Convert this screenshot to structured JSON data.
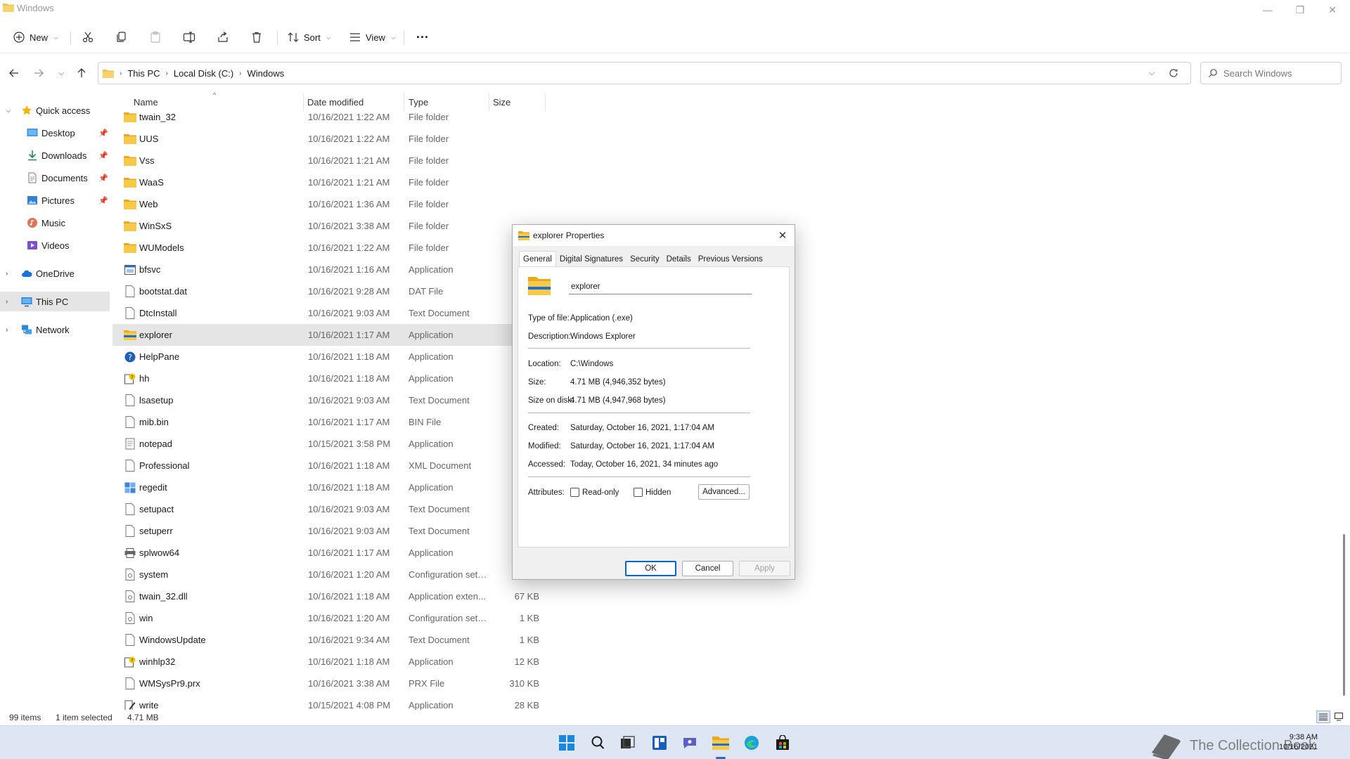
{
  "window": {
    "title": "Windows",
    "controls": {
      "minimize": "—",
      "maximize": "❐",
      "close": "✕"
    }
  },
  "toolbar": {
    "new_label": "New",
    "sort_label": "Sort",
    "view_label": "View",
    "more_label": "···"
  },
  "address": {
    "crumbs": [
      "This PC",
      "Local Disk (C:)",
      "Windows"
    ],
    "search_placeholder": "Search Windows"
  },
  "sidebar": {
    "items": [
      {
        "label": "Quick access",
        "icon": "star-icon"
      },
      {
        "label": "Desktop",
        "icon": "desktop-icon"
      },
      {
        "label": "Downloads",
        "icon": "downloads-icon"
      },
      {
        "label": "Documents",
        "icon": "documents-icon"
      },
      {
        "label": "Pictures",
        "icon": "pictures-icon"
      },
      {
        "label": "Music",
        "icon": "music-icon"
      },
      {
        "label": "Videos",
        "icon": "videos-icon"
      },
      {
        "label": "OneDrive",
        "icon": "cloud-icon"
      },
      {
        "label": "This PC",
        "icon": "computer-icon"
      },
      {
        "label": "Network",
        "icon": "network-icon"
      }
    ]
  },
  "columns": {
    "name": "Name",
    "date": "Date modified",
    "type": "Type",
    "size": "Size"
  },
  "files": [
    {
      "name": "twain_32",
      "date": "10/16/2021 1:22 AM",
      "type": "File folder",
      "size": "",
      "icon": "folder"
    },
    {
      "name": "UUS",
      "date": "10/16/2021 1:22 AM",
      "type": "File folder",
      "size": "",
      "icon": "folder"
    },
    {
      "name": "Vss",
      "date": "10/16/2021 1:21 AM",
      "type": "File folder",
      "size": "",
      "icon": "folder"
    },
    {
      "name": "WaaS",
      "date": "10/16/2021 1:21 AM",
      "type": "File folder",
      "size": "",
      "icon": "folder"
    },
    {
      "name": "Web",
      "date": "10/16/2021 1:36 AM",
      "type": "File folder",
      "size": "",
      "icon": "folder"
    },
    {
      "name": "WinSxS",
      "date": "10/16/2021 3:38 AM",
      "type": "File folder",
      "size": "",
      "icon": "folder"
    },
    {
      "name": "WUModels",
      "date": "10/16/2021 1:22 AM",
      "type": "File folder",
      "size": "",
      "icon": "folder"
    },
    {
      "name": "bfsvc",
      "date": "10/16/2021 1:16 AM",
      "type": "Application",
      "size": "",
      "icon": "app"
    },
    {
      "name": "bootstat.dat",
      "date": "10/16/2021 9:28 AM",
      "type": "DAT File",
      "size": "",
      "icon": "file"
    },
    {
      "name": "DtcInstall",
      "date": "10/16/2021 9:03 AM",
      "type": "Text Document",
      "size": "",
      "icon": "file"
    },
    {
      "name": "explorer",
      "date": "10/16/2021 1:17 AM",
      "type": "Application",
      "size": "",
      "icon": "explorer"
    },
    {
      "name": "HelpPane",
      "date": "10/16/2021 1:18 AM",
      "type": "Application",
      "size": "",
      "icon": "help"
    },
    {
      "name": "hh",
      "date": "10/16/2021 1:18 AM",
      "type": "Application",
      "size": "",
      "icon": "hh"
    },
    {
      "name": "lsasetup",
      "date": "10/16/2021 9:03 AM",
      "type": "Text Document",
      "size": "",
      "icon": "file"
    },
    {
      "name": "mib.bin",
      "date": "10/16/2021 1:17 AM",
      "type": "BIN File",
      "size": "",
      "icon": "file"
    },
    {
      "name": "notepad",
      "date": "10/15/2021 3:58 PM",
      "type": "Application",
      "size": "",
      "icon": "notepad"
    },
    {
      "name": "Professional",
      "date": "10/16/2021 1:18 AM",
      "type": "XML Document",
      "size": "",
      "icon": "file"
    },
    {
      "name": "regedit",
      "date": "10/16/2021 1:18 AM",
      "type": "Application",
      "size": "",
      "icon": "regedit"
    },
    {
      "name": "setupact",
      "date": "10/16/2021 9:03 AM",
      "type": "Text Document",
      "size": "",
      "icon": "file"
    },
    {
      "name": "setuperr",
      "date": "10/16/2021 9:03 AM",
      "type": "Text Document",
      "size": "",
      "icon": "file"
    },
    {
      "name": "splwow64",
      "date": "10/16/2021 1:17 AM",
      "type": "Application",
      "size": "",
      "icon": "printer"
    },
    {
      "name": "system",
      "date": "10/16/2021 1:20 AM",
      "type": "Configuration sett...",
      "size": "",
      "icon": "config"
    },
    {
      "name": "twain_32.dll",
      "date": "10/16/2021 1:18 AM",
      "type": "Application exten...",
      "size": "67 KB",
      "icon": "config"
    },
    {
      "name": "win",
      "date": "10/16/2021 1:20 AM",
      "type": "Configuration sett...",
      "size": "1 KB",
      "icon": "config"
    },
    {
      "name": "WindowsUpdate",
      "date": "10/16/2021 9:34 AM",
      "type": "Text Document",
      "size": "1 KB",
      "icon": "file"
    },
    {
      "name": "winhlp32",
      "date": "10/16/2021 1:18 AM",
      "type": "Application",
      "size": "12 KB",
      "icon": "hh"
    },
    {
      "name": "WMSysPr9.prx",
      "date": "10/16/2021 3:38 AM",
      "type": "PRX File",
      "size": "310 KB",
      "icon": "file"
    },
    {
      "name": "write",
      "date": "10/15/2021 4:08 PM",
      "type": "Application",
      "size": "28 KB",
      "icon": "write"
    }
  ],
  "selected_file": "explorer",
  "status": {
    "items": "99 items",
    "selected": "1 item selected",
    "size": "4.71 MB"
  },
  "taskbar": {
    "time": "9:38 AM",
    "date": "10/16/2021",
    "watermark": "The Collection Book"
  },
  "dialog": {
    "title": "explorer Properties",
    "tabs": [
      "General",
      "Digital Signatures",
      "Security",
      "Details",
      "Previous Versions"
    ],
    "active_tab": "General",
    "name_value": "explorer",
    "props": {
      "type_label": "Type of file:",
      "type_value": "Application (.exe)",
      "desc_label": "Description:",
      "desc_value": "Windows Explorer",
      "loc_label": "Location:",
      "loc_value": "C:\\Windows",
      "size_label": "Size:",
      "size_value": "4.71 MB (4,946,352 bytes)",
      "disk_label": "Size on disk:",
      "disk_value": "4.71 MB (4,947,968 bytes)",
      "created_label": "Created:",
      "created_value": "Saturday, October 16, 2021, 1:17:04 AM",
      "modified_label": "Modified:",
      "modified_value": "Saturday, October 16, 2021, 1:17:04 AM",
      "accessed_label": "Accessed:",
      "accessed_value": "Today, October 16, 2021, 34 minutes ago",
      "attr_label": "Attributes:"
    },
    "readonly_label": "Read-only",
    "hidden_label": "Hidden",
    "advanced_label": "Advanced...",
    "ok_label": "OK",
    "cancel_label": "Cancel",
    "apply_label": "Apply"
  },
  "colors": {
    "accent": "#0a64c8",
    "folder": "#f2c14e",
    "selection": "#e5e5e5",
    "taskbar": "#dde6f2"
  }
}
